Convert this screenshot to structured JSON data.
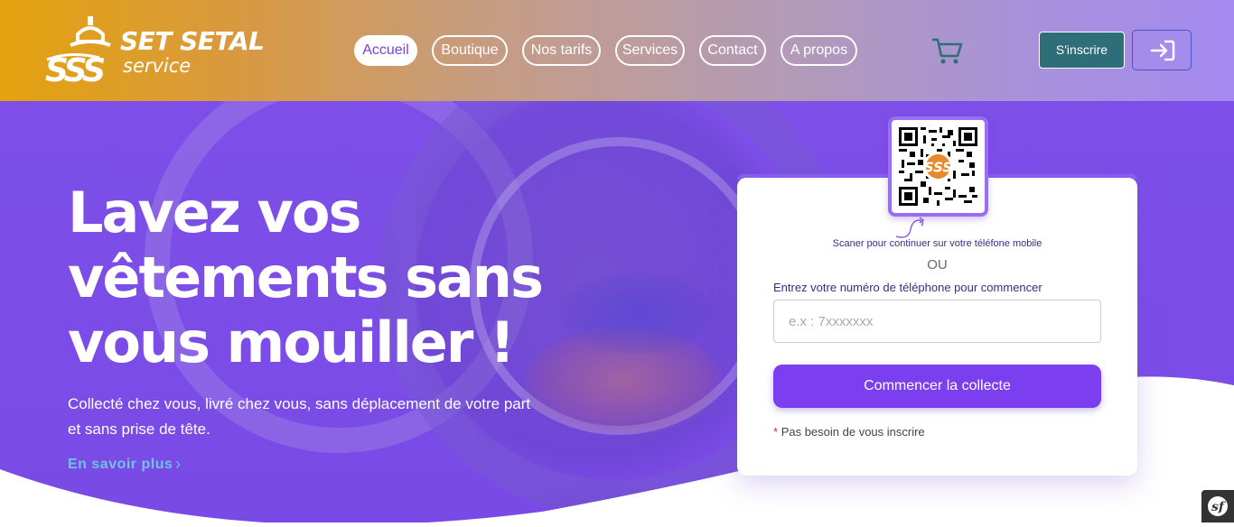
{
  "brand": {
    "name": "SET SETAL",
    "sub": "service"
  },
  "nav": [
    {
      "label": "Accueil",
      "active": true
    },
    {
      "label": "Boutique",
      "active": false
    },
    {
      "label": "Nos tarifs",
      "active": false
    },
    {
      "label": "Services",
      "active": false
    },
    {
      "label": "Contact",
      "active": false
    },
    {
      "label": "A propos",
      "active": false
    }
  ],
  "header": {
    "signup_label": "S'inscrire",
    "cart_icon": "cart-icon",
    "login_icon": "login-icon"
  },
  "hero": {
    "title": "Lavez vos vêtements sans vous mouiller !",
    "subtitle": "Collecté chez vous, livré chez vous, sans déplacement de votre part et sans prise de tête.",
    "learn_more": "En savoir plus",
    "learn_more_icon": "chevron-right-icon"
  },
  "card": {
    "scan_text": "Scaner pour continuer sur votre téléfone mobile",
    "or_text": "OU",
    "phone_label": "Entrez votre numéro de téléphone pour commencer",
    "phone_placeholder": "e.x : 7xxxxxxx",
    "phone_value": "",
    "start_button": "Commencer la collecte",
    "note_star": "*",
    "note_text": "Pas besoin de vous inscrire"
  },
  "colors": {
    "accent": "#7b3ff0",
    "signup": "#2e6e78",
    "link": "#6ec3e0"
  }
}
